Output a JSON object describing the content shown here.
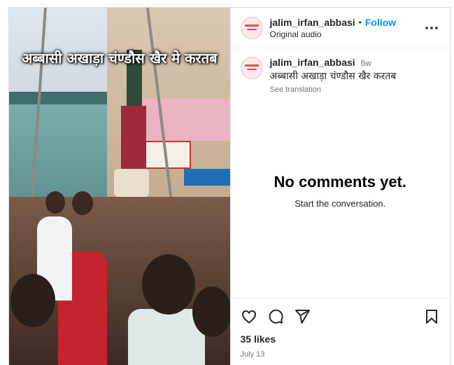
{
  "post": {
    "media": {
      "overlay_text": "अब्बासी अखाड़ा चंण्डौस खैर मे करतब"
    },
    "header": {
      "avatar_icon": "profile-avatar",
      "username": "jalim_irfan_abbasi",
      "separator": "•",
      "follow_label": "Follow",
      "audio_label": "Original audio",
      "more_icon": "more-options-icon"
    },
    "caption": {
      "username": "jalim_irfan_abbasi",
      "time": "6w",
      "text": "अब्बासी अखाड़ा चंण्डौस खैर करतब",
      "see_translation": "See translation"
    },
    "comments": {
      "empty_title": "No comments yet.",
      "empty_subtitle": "Start the conversation."
    },
    "actions": {
      "icons": [
        "heart-icon",
        "comment-icon",
        "share-icon",
        "bookmark-icon"
      ],
      "likes": "35 likes",
      "date": "July 13"
    }
  }
}
